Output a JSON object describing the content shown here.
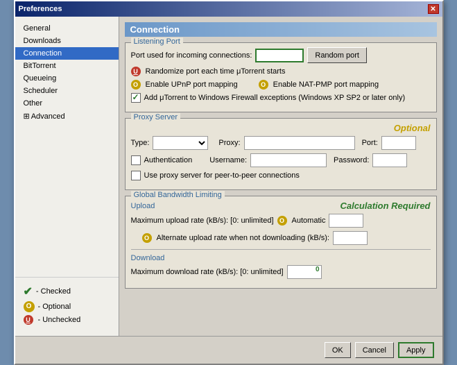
{
  "dialog": {
    "title": "Preferences",
    "close_label": "✕"
  },
  "sidebar": {
    "items": [
      {
        "label": "General",
        "active": false
      },
      {
        "label": "Downloads",
        "active": false
      },
      {
        "label": "Connection",
        "active": true
      },
      {
        "label": "BitTorrent",
        "active": false
      },
      {
        "label": "Queueing",
        "active": false
      },
      {
        "label": "Scheduler",
        "active": false
      },
      {
        "label": "Other",
        "active": false
      },
      {
        "label": "Advanced",
        "active": false,
        "expand": true
      }
    ],
    "legend": [
      {
        "icon": "check",
        "text": "- Checked"
      },
      {
        "icon": "optional",
        "text": "- Optional"
      },
      {
        "icon": "uncheck",
        "text": "- Unchecked"
      }
    ]
  },
  "main": {
    "section_title": "Connection",
    "listening_port": {
      "label": "Listening Port",
      "port_label": "Port used for incoming connections:",
      "random_port_btn": "Random port",
      "randomize_label": "Randomize port each time μTorrent starts",
      "upnp_label": "Enable UPnP port mapping",
      "natpmp_label": "Enable NAT-PMP port mapping",
      "firewall_label": "Add μTorrent to Windows Firewall exceptions (Windows XP SP2 or later only)"
    },
    "proxy_server": {
      "label": "Proxy Server",
      "optional_text": "Optional",
      "type_label": "Type:",
      "proxy_label": "Proxy:",
      "port_label": "Port:",
      "auth_label": "Authentication",
      "username_label": "Username:",
      "password_label": "Password:",
      "peer_proxy_label": "Use proxy server for peer-to-peer connections"
    },
    "bandwidth": {
      "label": "Global Bandwidth Limiting",
      "calc_text": "Calculation Required",
      "upload_label": "Upload",
      "max_upload_label": "Maximum upload rate (kB/s): [0: unlimited]",
      "automatic_label": "Automatic",
      "alt_upload_label": "Alternate upload rate when not downloading (kB/s):",
      "download_label": "Download",
      "max_download_label": "Maximum download rate (kB/s): [0: unlimited]",
      "download_value": "0"
    }
  },
  "footer": {
    "ok_label": "OK",
    "cancel_label": "Cancel",
    "apply_label": "Apply"
  }
}
